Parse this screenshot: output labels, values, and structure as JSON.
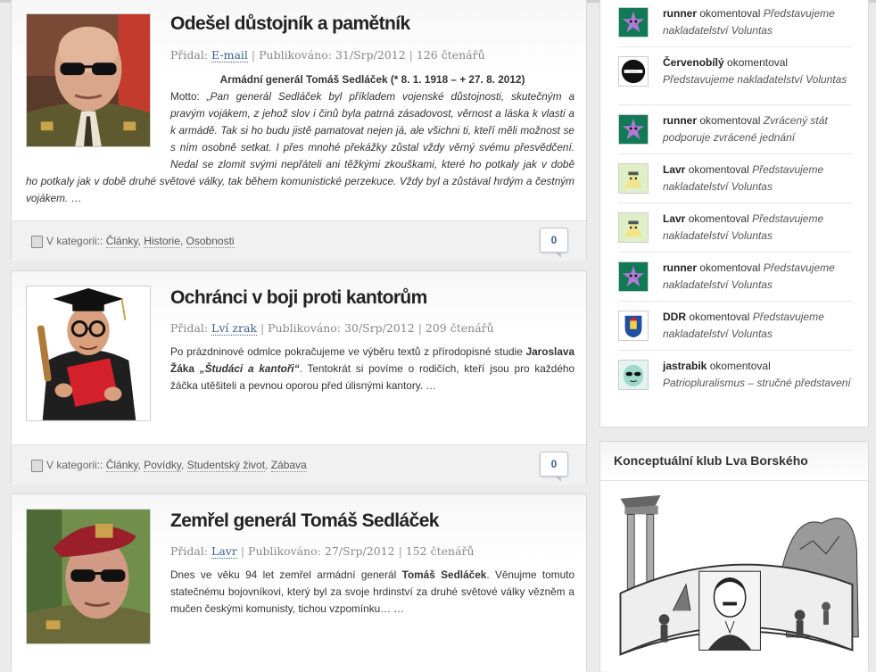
{
  "posts": [
    {
      "title": "Odešel důstojník a pamětník",
      "meta": {
        "added_label": "Přidal:",
        "author": "E-mail",
        "published_label": "Publikováno:",
        "date": "31/Srp/2012",
        "readers": "126 čtenářů"
      },
      "heading": "Armádní generál Tomáš Sedláček (* 8. 1. 1918 – + 27. 8. 2012)",
      "motto_label": "Motto:",
      "motto_text": "„Pan generál Sedláček byl příkladem vojenské důstojnosti, skutečným a pravým vojákem, z jehož slov i činů byla patrná zásadovost, věrnost a láska k vlasti a k armádě. Tak si ho budu jistě pamatovat nejen já, ale všichni ti, kteří měli možnost se s ním osobně setkat. I přes mnohé překážky zůstal vždy věrný svému přesvědčení. Nedal se zlomit svými nepřáteli ani těžkými zkouškami, které ho potkaly jak v době druhé světové války, tak během komunistické perzekuce. Vždy byl a zůstával hrdým a čestným vojákem.",
      "ellipsis": "…",
      "category_label": "V kategorii::",
      "categories": [
        "Články",
        "Historie",
        "Osobnosti"
      ],
      "comments": "0"
    },
    {
      "title": "Ochránci v boji proti kantorům",
      "meta": {
        "added_label": "Přidal:",
        "author": "Lví zrak",
        "published_label": "Publikováno:",
        "date": "30/Srp/2012",
        "readers": "209 čtenářů"
      },
      "excerpt_before": "Po prázdninové odmlce pokračujeme ve výběru textů z přírodopisné studie",
      "excerpt_bold": "Jaroslava Žáka",
      "excerpt_bold_italic": "„Študáci a kantoři“",
      "excerpt_after": ". Tentokrát si povíme o rodičích, kteří jsou pro každého žáčka utěšiteli a pevnou oporou před úlisnými kantory. …",
      "category_label": "V kategorii::",
      "categories": [
        "Články",
        "Povídky",
        "Studentský život",
        "Zábava"
      ],
      "comments": "0"
    },
    {
      "title": "Zemřel generál Tomáš Sedláček",
      "meta": {
        "added_label": "Přidal:",
        "author": "Lavr",
        "published_label": "Publikováno:",
        "date": "27/Srp/2012",
        "readers": "152 čtenářů"
      },
      "excerpt_before": "Dnes ve věku 94 let zemřel armádní generál",
      "excerpt_bold": "Tomáš Sedláček",
      "excerpt_after": ". Věnujme tomuto statečnému bojovníkovi, který byl za svoje hrdinství za druhé světové války vězněm a mučen českými komunisty, tichou vzpomínku… …"
    }
  ],
  "recent_comments": [
    {
      "user": "runner",
      "verb": "okomentoval",
      "post": "Představujeme nakladatelství Voluntas",
      "avatar": "star-avatar"
    },
    {
      "user": "Červenobílý",
      "verb": "okomentoval",
      "post": "Představujeme nakladatelství Voluntas",
      "avatar": "logo-avatar"
    },
    {
      "user": "runner",
      "verb": "okomentoval",
      "post": "Zvrácený stát podporuje zvrácené jednání",
      "avatar": "star-avatar"
    },
    {
      "user": "Lavr",
      "verb": "okomentoval",
      "post": "Představujeme nakladatelství Voluntas",
      "avatar": "lamp-avatar"
    },
    {
      "user": "Lavr",
      "verb": "okomentoval",
      "post": "Představujeme nakladatelství Voluntas",
      "avatar": "lamp-avatar"
    },
    {
      "user": "runner",
      "verb": "okomentoval",
      "post": "Představujeme nakladatelství Voluntas",
      "avatar": "star-avatar"
    },
    {
      "user": "DDR",
      "verb": "okomentoval",
      "post": "Představujeme nakladatelství Voluntas",
      "avatar": "crest-avatar"
    },
    {
      "user": "jastrabik",
      "verb": "okomentoval",
      "post": "Patriopluralismus – stručné představení",
      "avatar": "alien-avatar"
    }
  ],
  "sidebar": {
    "club_title": "Konceptuální klub Lva Borského"
  },
  "colors": {
    "link": "#3c5f8f",
    "avatar_star_bg": "#0f7a55",
    "avatar_star": "#b07ad6"
  }
}
